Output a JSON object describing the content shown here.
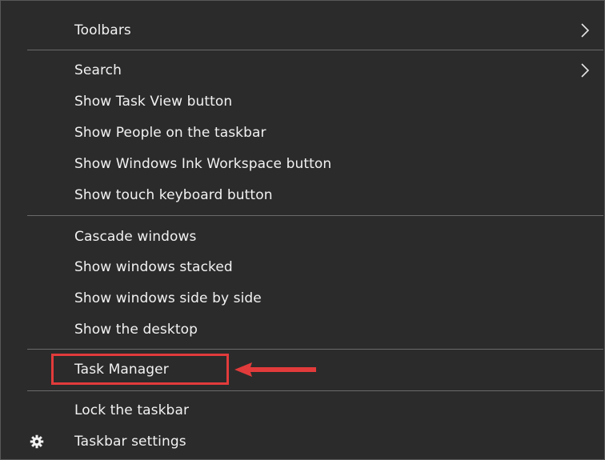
{
  "context_menu": {
    "items": [
      {
        "label": "Toolbars",
        "submenu": true
      },
      {
        "label": "Search",
        "submenu": true
      },
      {
        "label": "Show Task View button"
      },
      {
        "label": "Show People on the taskbar"
      },
      {
        "label": "Show Windows Ink Workspace button"
      },
      {
        "label": "Show touch keyboard button"
      },
      {
        "label": "Cascade windows"
      },
      {
        "label": "Show windows stacked"
      },
      {
        "label": "Show windows side by side"
      },
      {
        "label": "Show the desktop"
      },
      {
        "label": "Task Manager",
        "highlighted": true
      },
      {
        "label": "Lock the taskbar"
      },
      {
        "label": "Taskbar settings",
        "icon": "gear-icon"
      }
    ]
  },
  "colors": {
    "menu_background": "#2b2b2b",
    "text": "#f2f2f2",
    "separator": "#6a6a6a",
    "annotation": "#e23b3b"
  }
}
